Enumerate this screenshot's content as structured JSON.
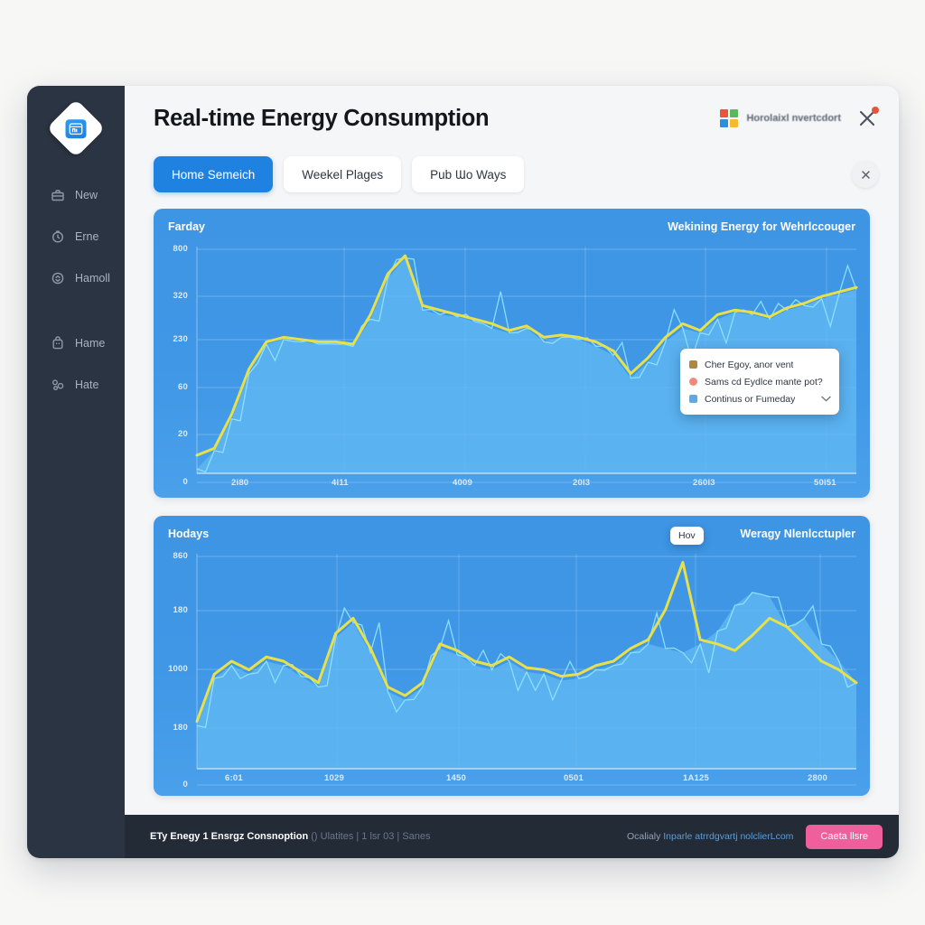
{
  "window": {
    "title": "Real-time Energy Consumption"
  },
  "colors": {
    "accent": "#1f81e0",
    "sidebar_bg": "#2b3442",
    "footer_bg": "#222b36",
    "chart_bg": "#3f97e6",
    "line": "#e8e04a",
    "area": "#62b9f2",
    "spike": "#8fe2ff",
    "cta_pink": "#ef5f9c",
    "badge_red": "#e8533f"
  },
  "sidebar": {
    "logo_icon": "app-logo-icon",
    "items": [
      {
        "label": "New",
        "icon": "briefcase-icon"
      },
      {
        "label": "Erne",
        "icon": "clock-icon"
      },
      {
        "label": "Hamoll",
        "icon": "refresh-circle-icon"
      },
      {
        "label": "Hame",
        "icon": "bag-icon"
      },
      {
        "label": "Hate",
        "icon": "share-nodes-icon"
      }
    ]
  },
  "topbar": {
    "brand_icon": "four-color-grid-icon",
    "brand_text": "Horolaixl nvertcdort",
    "notify_icon": "close-x-icon",
    "brand_squares": [
      "#e8553a",
      "#5cb85c",
      "#2f8ce0",
      "#f5bb2e"
    ]
  },
  "tabs": {
    "items": [
      {
        "label": "Home Semeich",
        "active": true
      },
      {
        "label": "Weekel Plages",
        "active": false
      },
      {
        "label": "Pub Ɯo Ways",
        "active": false
      }
    ],
    "close_icon": "close-icon"
  },
  "legend": {
    "rows": [
      {
        "label": "Cher Egoy, anor vent",
        "color": "#b08642",
        "shape": "square"
      },
      {
        "label": "Sams cd Eydlce mante pot?",
        "color": "#f08a7a",
        "shape": "dot"
      },
      {
        "label": "Continus or Fumeday",
        "color": "#5ea9e8",
        "shape": "square"
      }
    ],
    "chevron_icon": "chevron-down-icon"
  },
  "tooltip": {
    "label": "Hov"
  },
  "footer": {
    "title": "ETy Enegy 1 Ensrgz Consnoption",
    "meta": "() Ulatites | 1 lsr 03 | Sanes",
    "link_prefix": "Ocalialy",
    "link_text": "Inparle atrrdgvartj nolclierLcom",
    "button_label": "Caeta llsre"
  },
  "chart_data": [
    {
      "id": "chart-1",
      "type": "area",
      "title": "Farday",
      "title_right": "Wekining Energy for Wehrlccouger",
      "xlabel": "",
      "ylabel": "",
      "grid": true,
      "legend_position": "inside-right",
      "yticks": [
        "800",
        "320",
        "230",
        "60",
        "20",
        "0"
      ],
      "ytick_y": [
        45,
        97,
        145,
        198,
        250,
        303
      ],
      "xticks": [
        "2i80",
        "4l11",
        "4009",
        "20l3",
        "260l3",
        "50l51"
      ],
      "xtick_x": [
        52,
        163,
        297,
        430,
        563,
        697
      ],
      "series": [
        {
          "name": "line",
          "values": [
            8,
            11,
            26,
            46,
            58,
            60,
            59,
            58,
            58,
            57,
            70,
            88,
            96,
            74,
            72,
            70,
            68,
            66,
            63,
            65,
            60,
            61,
            60,
            58,
            54,
            44,
            51,
            60,
            66,
            63,
            70,
            72,
            71,
            69,
            73,
            75,
            78,
            80,
            82
          ]
        },
        {
          "name": "area",
          "values": [
            2,
            10,
            24,
            44,
            57,
            59,
            58,
            57,
            57,
            56,
            68,
            86,
            95,
            72,
            70,
            69,
            67,
            64,
            62,
            64,
            58,
            60,
            59,
            56,
            52,
            42,
            49,
            58,
            64,
            62,
            68,
            71,
            70,
            68,
            72,
            74,
            77,
            79,
            81
          ]
        }
      ],
      "ylim": [
        0,
        100
      ]
    },
    {
      "id": "chart-2",
      "type": "area",
      "title": "Hodays",
      "title_right": "Weragy Nlenlcctupler",
      "xlabel": "",
      "ylabel": "",
      "grid": true,
      "legend_position": "none",
      "yticks": [
        "860",
        "180",
        "1000",
        "180",
        "0"
      ],
      "ytick_y": [
        45,
        105,
        170,
        235,
        298
      ],
      "xticks": [
        "6:01",
        "1029",
        "1450",
        "0501",
        "1A125",
        "2800"
      ],
      "xtick_x": [
        45,
        155,
        290,
        420,
        552,
        690
      ],
      "series": [
        {
          "name": "line",
          "values": [
            22,
            44,
            50,
            46,
            52,
            50,
            45,
            40,
            63,
            70,
            56,
            38,
            34,
            40,
            58,
            55,
            50,
            48,
            52,
            47,
            46,
            43,
            44,
            48,
            50,
            56,
            60,
            74,
            96,
            60,
            58,
            55,
            62,
            70,
            66,
            58,
            50,
            46,
            40
          ]
        },
        {
          "name": "area",
          "values": [
            20,
            42,
            48,
            44,
            50,
            48,
            43,
            38,
            61,
            68,
            54,
            36,
            32,
            38,
            56,
            53,
            48,
            46,
            50,
            45,
            44,
            41,
            42,
            46,
            48,
            54,
            58,
            56,
            54,
            58,
            64,
            76,
            82,
            80,
            66,
            70,
            58,
            50,
            40
          ]
        }
      ],
      "ylim": [
        0,
        100
      ]
    }
  ]
}
